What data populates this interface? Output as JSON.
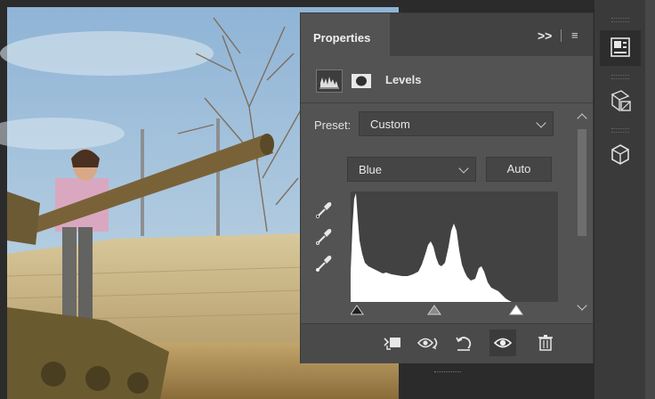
{
  "panel": {
    "tab_title": "Properties",
    "collapse_glyph": ">>",
    "menu_glyph": "≡",
    "adjustment_name": "Levels",
    "preset_label": "Preset:",
    "preset_value": "Custom",
    "channel_value": "Blue",
    "auto_label": "Auto"
  },
  "levels": {
    "input_black": 0,
    "input_gamma_fraction": 0.49,
    "input_white_fraction": 0.9
  },
  "icons": {
    "panel": [
      "levels-histogram-icon",
      "layer-mask-icon",
      "black-eyedropper-icon",
      "gray-eyedropper-icon",
      "white-eyedropper-icon"
    ],
    "footer": [
      "clip-to-layer-icon",
      "view-previous-state-icon",
      "reset-adjustment-icon",
      "toggle-visibility-icon",
      "delete-adjustment-icon"
    ],
    "dock": [
      "properties-icon",
      "3d-transform-icon",
      "3d-cube-icon"
    ]
  },
  "colors": {
    "panel_bg": "#535353",
    "header_bg": "#424242",
    "histogram_fill": "#ffffff",
    "histogram_bg": "#424242"
  }
}
